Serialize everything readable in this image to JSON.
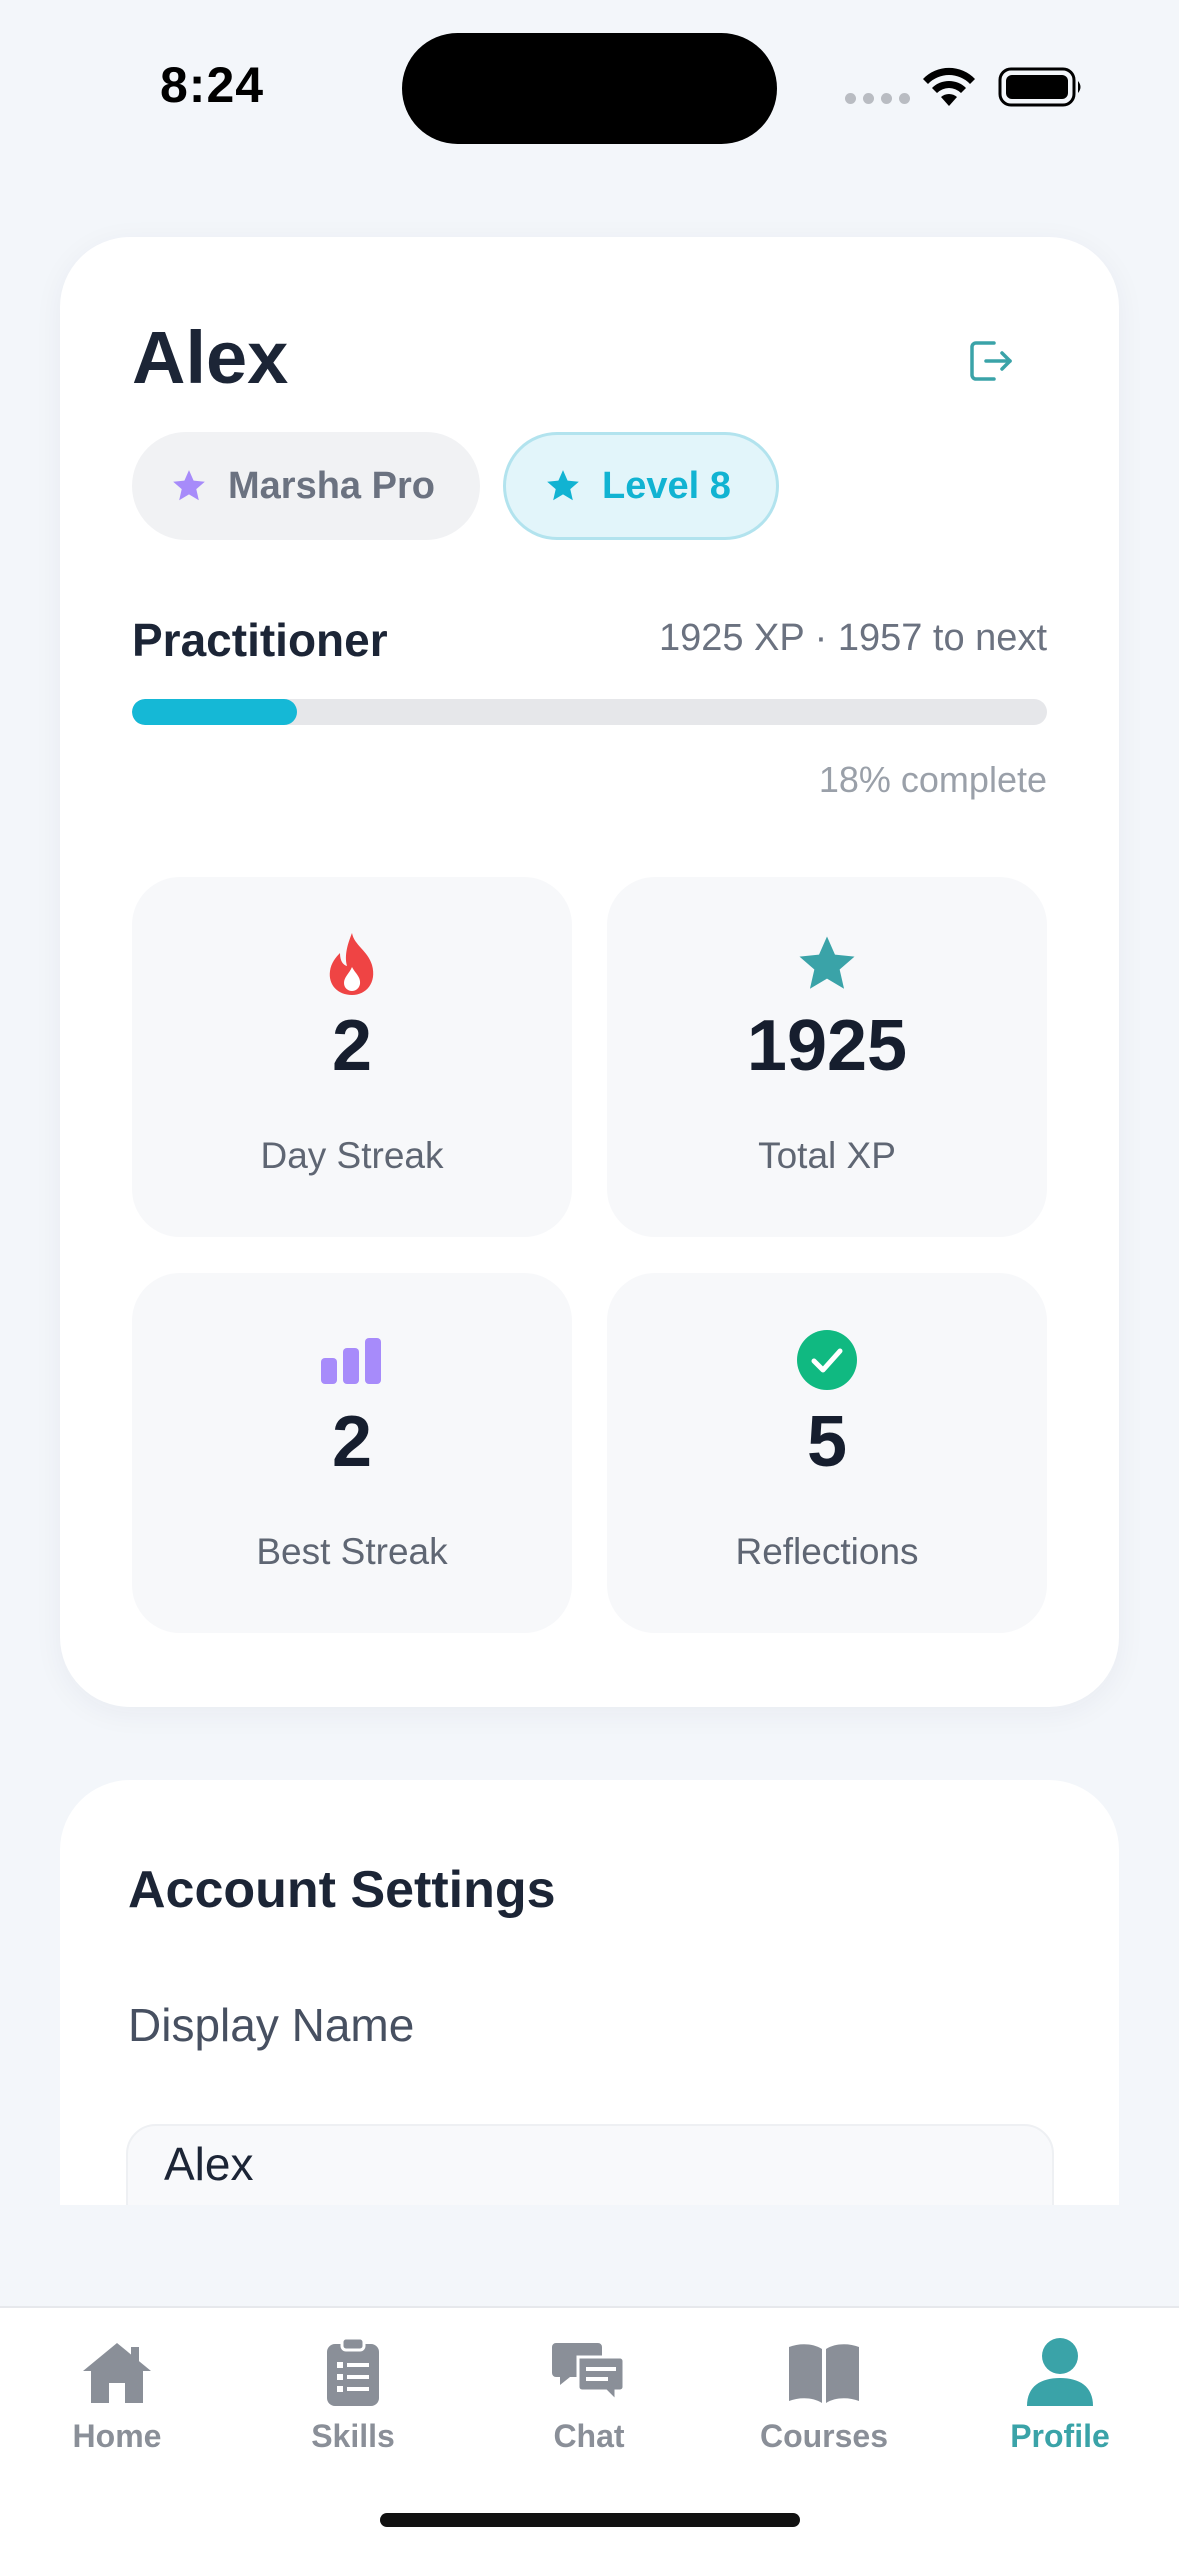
{
  "status_bar": {
    "time": "8:24"
  },
  "profile": {
    "name": "Alex",
    "plan_chip": "Marsha Pro",
    "level_chip": "Level 8",
    "rank": "Practitioner",
    "xp_current": "1925 XP",
    "xp_separator": "·",
    "xp_next": "1957 to next",
    "progress_percent": 18,
    "progress_label": "18% complete"
  },
  "stats": [
    {
      "icon": "flame-icon",
      "value": "2",
      "label": "Day Streak"
    },
    {
      "icon": "star-icon",
      "value": "1925",
      "label": "Total XP"
    },
    {
      "icon": "bar-chart-icon",
      "value": "2",
      "label": "Best Streak"
    },
    {
      "icon": "check-circle-icon",
      "value": "5",
      "label": "Reflections"
    }
  ],
  "settings": {
    "title": "Account Settings",
    "display_name_label": "Display Name",
    "display_name_value": "Alex"
  },
  "tabs": [
    {
      "label": "Home",
      "icon": "home-icon",
      "active": false
    },
    {
      "label": "Skills",
      "icon": "clipboard-icon",
      "active": false
    },
    {
      "label": "Chat",
      "icon": "chat-icon",
      "active": false
    },
    {
      "label": "Courses",
      "icon": "book-icon",
      "active": false
    },
    {
      "label": "Profile",
      "icon": "person-icon",
      "active": true
    }
  ],
  "colors": {
    "accent_teal": "#3aa3a8",
    "progress_cyan": "#15b8d6",
    "plan_star_purple": "#a78bfa",
    "flame_red": "#ef4444",
    "check_green": "#10b981"
  }
}
